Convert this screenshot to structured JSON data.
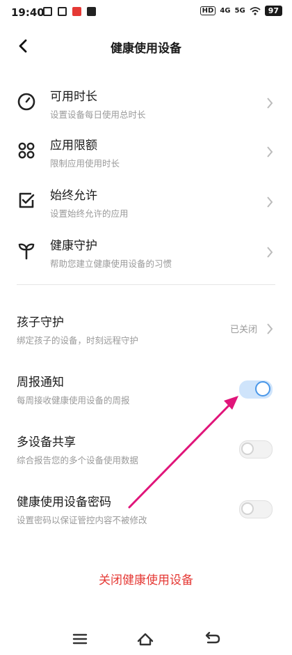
{
  "status": {
    "time": "19:40",
    "battery": "97",
    "net1": "4G",
    "net2": "5G",
    "hd": "HD"
  },
  "header": {
    "title": "健康使用设备"
  },
  "menu": [
    {
      "title": "可用时长",
      "subtitle": "设置设备每日使用总时长",
      "icon": "clock-icon"
    },
    {
      "title": "应用限额",
      "subtitle": "限制应用使用时长",
      "icon": "apps-grid-icon"
    },
    {
      "title": "始终允许",
      "subtitle": "设置始终允许的应用",
      "icon": "checkbox-icon"
    },
    {
      "title": "健康守护",
      "subtitle": "帮助您建立健康使用设备的习惯",
      "icon": "sprout-icon"
    }
  ],
  "child_guard": {
    "title": "孩子守护",
    "subtitle": "绑定孩子的设备，时刻远程守护",
    "status": "已关闭"
  },
  "toggles": [
    {
      "title": "周报通知",
      "subtitle": "每周接收健康使用设备的周报",
      "on": true
    },
    {
      "title": "多设备共享",
      "subtitle": "综合报告您的多个设备使用数据",
      "on": false
    },
    {
      "title": "健康使用设备密码",
      "subtitle": "设置密码以保证管控内容不被修改",
      "on": false
    }
  ],
  "footer": {
    "close_label": "关闭健康使用设备"
  },
  "colors": {
    "accent": "#4a97e8",
    "danger": "#e53935",
    "annotation": "#e0157a"
  }
}
